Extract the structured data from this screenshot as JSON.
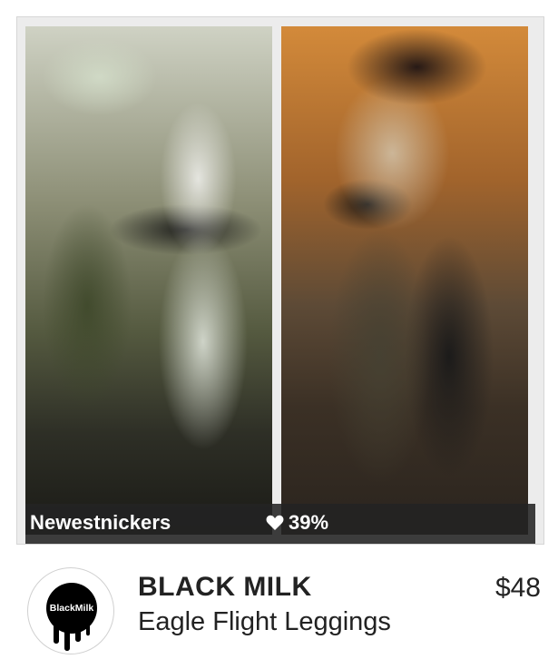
{
  "post": {
    "username": "Newestnickers",
    "like_percent": "39%",
    "like_icon": "heart-icon"
  },
  "product": {
    "brand": "BLACK MILK",
    "name": "Eagle Flight Leggings",
    "price": "$48",
    "logo_text": "BlackMilk"
  },
  "colors": {
    "caption_bar": "#232323",
    "text_dark": "#222222",
    "card_bg": "#ececec"
  }
}
